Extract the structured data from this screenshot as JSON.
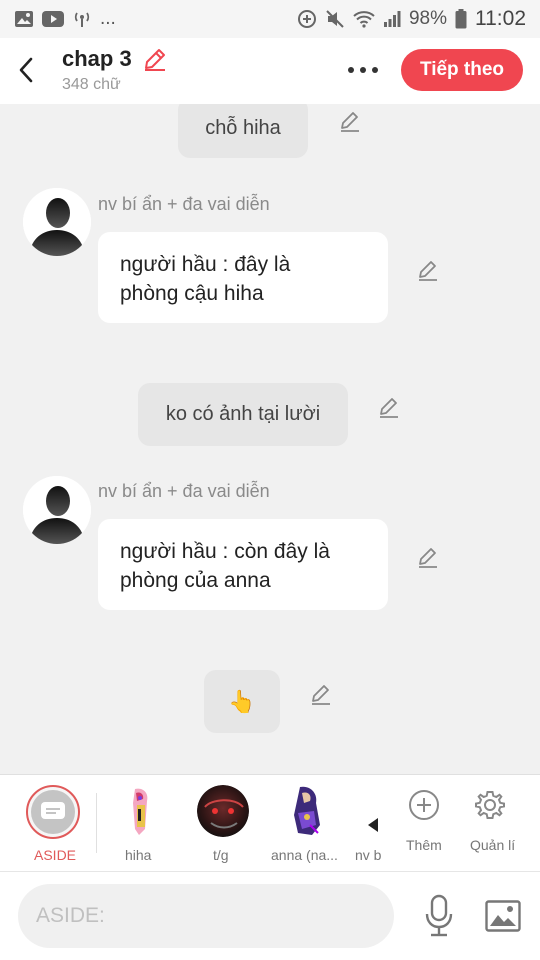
{
  "status_bar": {
    "left_icons": [
      "gallery-icon",
      "youtube-icon",
      "hotspot-icon"
    ],
    "ellipsis": "...",
    "right_icons": [
      "data-saver-icon",
      "mute-icon",
      "wifi-icon",
      "signal-icon",
      "battery-icon"
    ],
    "battery": "98%",
    "time": "11:02"
  },
  "header": {
    "title": "chap 3",
    "word_count": "348 chữ",
    "next_label": "Tiếp theo",
    "accent": "#f04650"
  },
  "messages": [
    {
      "type": "aside",
      "text": "chỗ hiha"
    },
    {
      "type": "character",
      "name": "nv bí ẩn + đa vai diễn",
      "lines": [
        "người hầu : đây là",
        "phòng cậu hiha"
      ]
    },
    {
      "type": "aside",
      "text": "ko có ảnh tại lười"
    },
    {
      "type": "character",
      "name": "nv bí ẩn + đa vai diễn",
      "lines": [
        "người hầu : còn đây là",
        "phòng của anna"
      ]
    },
    {
      "type": "aside",
      "text": "👆"
    }
  ],
  "character_bar": {
    "items": [
      {
        "label": "ASIDE",
        "selected": true
      },
      {
        "label": "hiha"
      },
      {
        "label": "t/g"
      },
      {
        "label": "anna (na..."
      },
      {
        "label": "nv b"
      }
    ],
    "add_label": "Thêm",
    "manage_label": "Quản lí"
  },
  "input": {
    "placeholder": "ASIDE:"
  }
}
